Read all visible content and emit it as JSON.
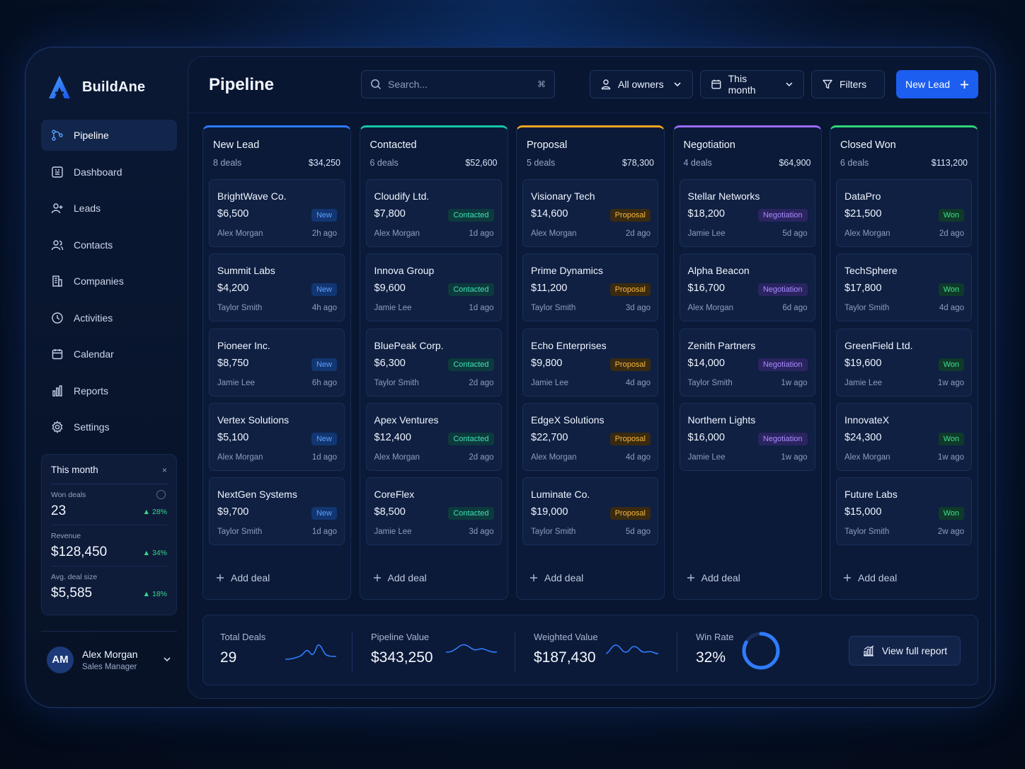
{
  "brand": {
    "name": "BuildAne"
  },
  "nav": [
    {
      "label": "Pipeline",
      "icon": "pipeline-icon",
      "active": true
    },
    {
      "label": "Dashboard",
      "icon": "dashboard-icon"
    },
    {
      "label": "Leads",
      "icon": "leads-icon"
    },
    {
      "label": "Contacts",
      "icon": "contacts-icon"
    },
    {
      "label": "Companies",
      "icon": "companies-icon"
    },
    {
      "label": "Activities",
      "icon": "activities-icon"
    },
    {
      "label": "Calendar",
      "icon": "calendar-icon"
    },
    {
      "label": "Reports",
      "icon": "reports-icon"
    },
    {
      "label": "Settings",
      "icon": "settings-icon"
    }
  ],
  "month_stats": {
    "title": "This month",
    "close": "×",
    "items": [
      {
        "label": "Won deals",
        "value": "23",
        "delta": "28%"
      },
      {
        "label": "Revenue",
        "value": "$128,450",
        "delta": "34%"
      },
      {
        "label": "Avg. deal size",
        "value": "$5,585",
        "delta": "18%"
      }
    ]
  },
  "user": {
    "initials": "AM",
    "name": "Alex Morgan",
    "role": "Sales Manager"
  },
  "header": {
    "title": "Pipeline",
    "search_placeholder": "Search...",
    "search_shortcut": "⌘",
    "owner_filter": "All owners",
    "date_filter": "This month",
    "filters_label": "Filters",
    "new_lead_label": "New Lead"
  },
  "colors": {
    "accent": "#1c5ef0",
    "new": "#2e7bff",
    "contacted": "#18c7a6",
    "proposal": "#f4a623",
    "negotiation": "#9b6bff",
    "won": "#2fd67a"
  },
  "columns": [
    {
      "title": "New Lead",
      "count": "8 deals",
      "total": "$34,250",
      "color": "#2e7bff",
      "badge_bg": "#123672",
      "badge_fg": "#5aa0ff",
      "cards": [
        {
          "name": "BrightWave Co.",
          "value": "$6,500",
          "badge": "New",
          "owner": "Alex Morgan",
          "time": "2h ago"
        },
        {
          "name": "Summit Labs",
          "value": "$4,200",
          "badge": "New",
          "owner": "Taylor Smith",
          "time": "4h ago"
        },
        {
          "name": "Pioneer Inc.",
          "value": "$8,750",
          "badge": "New",
          "owner": "Jamie Lee",
          "time": "6h ago"
        },
        {
          "name": "Vertex Solutions",
          "value": "$5,100",
          "badge": "New",
          "owner": "Alex Morgan",
          "time": "1d ago"
        },
        {
          "name": "NextGen Systems",
          "value": "$9,700",
          "badge": "New",
          "owner": "Taylor Smith",
          "time": "1d ago"
        }
      ]
    },
    {
      "title": "Contacted",
      "count": "6 deals",
      "total": "$52,600",
      "color": "#18c7a6",
      "badge_bg": "#0d3a3c",
      "badge_fg": "#3fe0b8",
      "cards": [
        {
          "name": "Cloudify Ltd.",
          "value": "$7,800",
          "badge": "Contacted",
          "owner": "Alex Morgan",
          "time": "1d ago"
        },
        {
          "name": "Innova Group",
          "value": "$9,600",
          "badge": "Contacted",
          "owner": "Jamie Lee",
          "time": "1d ago"
        },
        {
          "name": "BluePeak Corp.",
          "value": "$6,300",
          "badge": "Contacted",
          "owner": "Taylor Smith",
          "time": "2d ago"
        },
        {
          "name": "Apex Ventures",
          "value": "$12,400",
          "badge": "Contacted",
          "owner": "Alex Morgan",
          "time": "2d ago"
        },
        {
          "name": "CoreFlex",
          "value": "$8,500",
          "badge": "Contacted",
          "owner": "Jamie Lee",
          "time": "3d ago"
        }
      ]
    },
    {
      "title": "Proposal",
      "count": "5 deals",
      "total": "$78,300",
      "color": "#f4a623",
      "badge_bg": "#3a2a10",
      "badge_fg": "#f6b740",
      "cards": [
        {
          "name": "Visionary Tech",
          "value": "$14,600",
          "badge": "Proposal",
          "owner": "Alex Morgan",
          "time": "2d ago"
        },
        {
          "name": "Prime Dynamics",
          "value": "$11,200",
          "badge": "Proposal",
          "owner": "Taylor Smith",
          "time": "3d ago"
        },
        {
          "name": "Echo Enterprises",
          "value": "$9,800",
          "badge": "Proposal",
          "owner": "Jamie Lee",
          "time": "4d ago"
        },
        {
          "name": "EdgeX Solutions",
          "value": "$22,700",
          "badge": "Proposal",
          "owner": "Alex Morgan",
          "time": "4d ago"
        },
        {
          "name": "Luminate Co.",
          "value": "$19,000",
          "badge": "Proposal",
          "owner": "Taylor Smith",
          "time": "5d ago"
        }
      ]
    },
    {
      "title": "Negotiation",
      "count": "4 deals",
      "total": "$64,900",
      "color": "#9b6bff",
      "badge_bg": "#2a2460",
      "badge_fg": "#a98bff",
      "cards": [
        {
          "name": "Stellar Networks",
          "value": "$18,200",
          "badge": "Negotiation",
          "owner": "Jamie Lee",
          "time": "5d ago"
        },
        {
          "name": "Alpha Beacon",
          "value": "$16,700",
          "badge": "Negotiation",
          "owner": "Alex Morgan",
          "time": "6d ago"
        },
        {
          "name": "Zenith Partners",
          "value": "$14,000",
          "badge": "Negotiation",
          "owner": "Taylor Smith",
          "time": "1w ago"
        },
        {
          "name": "Northern Lights",
          "value": "$16,000",
          "badge": "Negotiation",
          "owner": "Jamie Lee",
          "time": "1w ago"
        }
      ]
    },
    {
      "title": "Closed Won",
      "count": "6 deals",
      "total": "$113,200",
      "color": "#2fd67a",
      "badge_bg": "#0f3a2a",
      "badge_fg": "#3fe08c",
      "cards": [
        {
          "name": "DataPro",
          "value": "$21,500",
          "badge": "Won",
          "owner": "Alex Morgan",
          "time": "2d ago"
        },
        {
          "name": "TechSphere",
          "value": "$17,800",
          "badge": "Won",
          "owner": "Taylor Smith",
          "time": "4d ago"
        },
        {
          "name": "GreenField Ltd.",
          "value": "$19,600",
          "badge": "Won",
          "owner": "Jamie Lee",
          "time": "1w ago"
        },
        {
          "name": "InnovateX",
          "value": "$24,300",
          "badge": "Won",
          "owner": "Alex Morgan",
          "time": "1w ago"
        },
        {
          "name": "Future Labs",
          "value": "$15,000",
          "badge": "Won",
          "owner": "Taylor Smith",
          "time": "2w ago"
        }
      ]
    }
  ],
  "add_deal_label": "Add deal",
  "summary": {
    "total_deals": {
      "label": "Total Deals",
      "value": "29"
    },
    "pipeline_value": {
      "label": "Pipeline Value",
      "value": "$343,250"
    },
    "weighted_value": {
      "label": "Weighted Value",
      "value": "$187,430"
    },
    "win_rate": {
      "label": "Win Rate",
      "value": "32%",
      "fraction": 0.32
    },
    "report_button": "View full report"
  }
}
